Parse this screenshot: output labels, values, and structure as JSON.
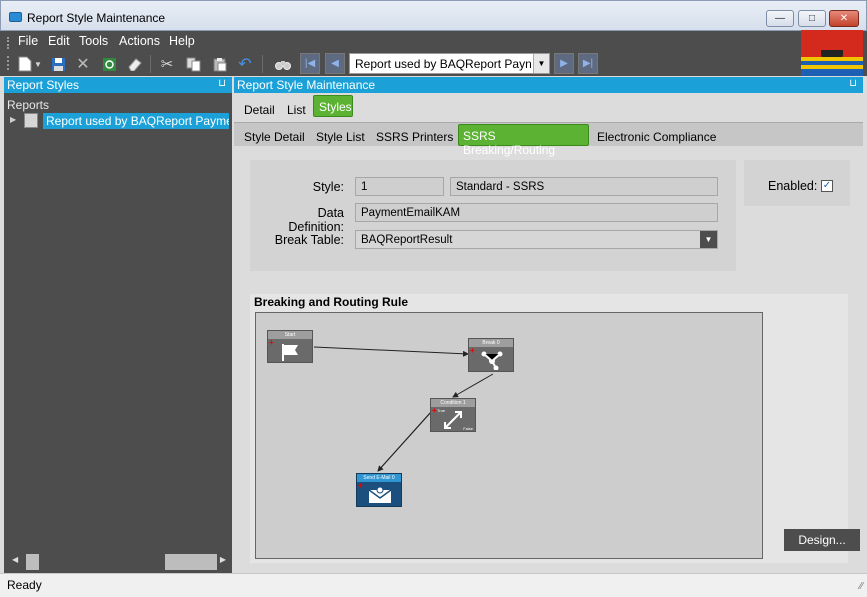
{
  "window": {
    "title": "Report Style Maintenance"
  },
  "menu": [
    "File",
    "Edit",
    "Tools",
    "Actions",
    "Help"
  ],
  "toolbar": {
    "record_combo": "Report used by BAQReport Payn"
  },
  "left_panel": {
    "title": "Report Styles",
    "tree_root": "Reports",
    "tree_item": "Report used by BAQReport Paymen"
  },
  "right_panel": {
    "title": "Report Style Maintenance",
    "tabs": [
      "Detail",
      "List",
      "Styles"
    ],
    "subtabs": [
      "Style Detail",
      "Style List",
      "SSRS Printers",
      "SSRS Breaking/Routing",
      "Electronic Compliance"
    ],
    "fields": {
      "style_label": "Style:",
      "style_value": "1",
      "style_desc": "Standard - SSRS",
      "datadef_label": "Data Definition:",
      "datadef_value": "PaymentEmailKAM",
      "breaktable_label": "Break Table:",
      "breaktable_value": "BAQReportResult",
      "enabled_label": "Enabled:"
    },
    "rule_title": "Breaking and Routing Rule",
    "design_button": "Design...",
    "nodes": {
      "start": "Start",
      "break": "Break 0",
      "condition": "Condition 1",
      "true_label": "True",
      "false_label": "False",
      "email": "Send E-Mail 0"
    }
  },
  "status": {
    "text": "Ready"
  },
  "colors": {
    "accent": "#1ba1d8",
    "active_tab": "#5bb233",
    "dark": "#4d4d4d"
  }
}
